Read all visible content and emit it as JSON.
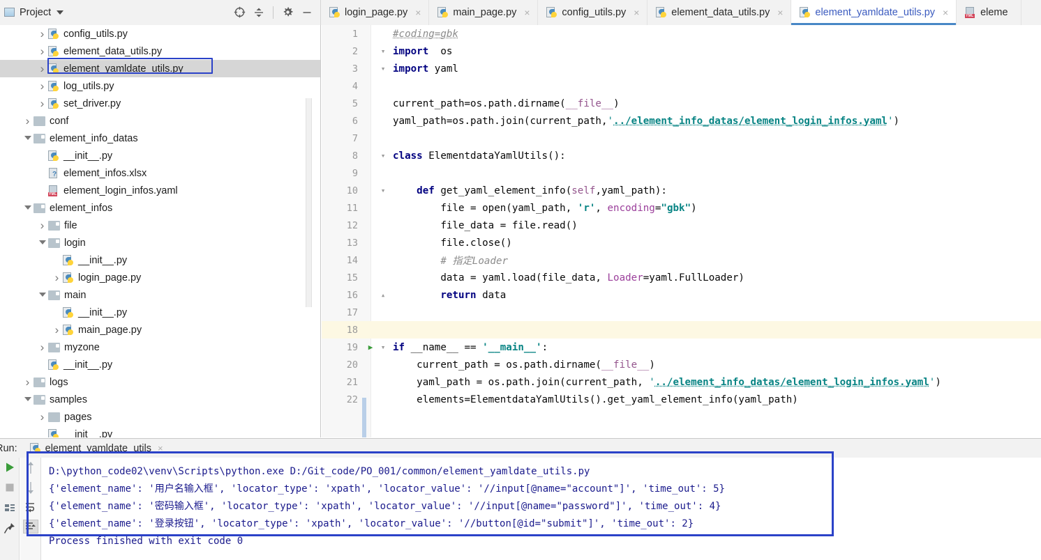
{
  "window": {
    "project_panel_title": "Project",
    "project_icon": "project-panel-icon",
    "dropdown_icon": "chevron-down-icon",
    "tools": [
      {
        "name": "locate-target-icon",
        "title": "Select Opened File"
      },
      {
        "name": "collapse-all-icon",
        "title": "Collapse All"
      },
      {
        "name": "gear-icon",
        "title": "Settings"
      },
      {
        "name": "minimize-icon",
        "title": "Hide"
      }
    ]
  },
  "tabs": [
    {
      "label": "login_page.py",
      "icon": "python-file-icon",
      "close": "×",
      "active": false
    },
    {
      "label": "main_page.py",
      "icon": "python-file-icon",
      "close": "×",
      "active": false
    },
    {
      "label": "config_utils.py",
      "icon": "python-file-icon",
      "close": "×",
      "active": false
    },
    {
      "label": "element_data_utils.py",
      "icon": "python-file-icon",
      "close": "×",
      "active": false
    },
    {
      "label": "element_yamldate_utils.py",
      "icon": "python-file-icon",
      "close": "×",
      "active": true
    },
    {
      "label": "eleme",
      "icon": "yaml-file-icon",
      "close": "",
      "active": false
    }
  ],
  "tree": [
    {
      "label": "config_utils.py",
      "indent": 2,
      "arrow": "collapsed",
      "icon": "python-file-icon",
      "selected": false
    },
    {
      "label": "element_data_utils.py",
      "indent": 2,
      "arrow": "collapsed",
      "icon": "python-file-icon",
      "selected": false
    },
    {
      "label": "element_yamldate_utils.py",
      "indent": 2,
      "arrow": "collapsed",
      "icon": "python-file-icon",
      "selected": true
    },
    {
      "label": "log_utils.py",
      "indent": 2,
      "arrow": "collapsed",
      "icon": "python-file-icon",
      "selected": false
    },
    {
      "label": "set_driver.py",
      "indent": 2,
      "arrow": "collapsed",
      "icon": "python-file-icon",
      "selected": false
    },
    {
      "label": "conf",
      "indent": 1,
      "arrow": "collapsed",
      "icon": "folder-icon",
      "selected": false
    },
    {
      "label": "element_info_datas",
      "indent": 1,
      "arrow": "expanded",
      "icon": "package-folder-icon",
      "selected": false
    },
    {
      "label": "__init__.py",
      "indent": 2,
      "arrow": "none",
      "icon": "python-file-icon",
      "selected": false
    },
    {
      "label": "element_infos.xlsx",
      "indent": 2,
      "arrow": "none",
      "icon": "xls-file-icon",
      "selected": false
    },
    {
      "label": "element_login_infos.yaml",
      "indent": 2,
      "arrow": "none",
      "icon": "yaml-file-icon",
      "selected": false
    },
    {
      "label": "element_infos",
      "indent": 1,
      "arrow": "expanded",
      "icon": "package-folder-icon",
      "selected": false
    },
    {
      "label": "file",
      "indent": 2,
      "arrow": "collapsed",
      "icon": "package-folder-icon",
      "selected": false
    },
    {
      "label": "login",
      "indent": 2,
      "arrow": "expanded",
      "icon": "package-folder-icon",
      "selected": false
    },
    {
      "label": "__init__.py",
      "indent": 3,
      "arrow": "none",
      "icon": "python-file-icon",
      "selected": false
    },
    {
      "label": "login_page.py",
      "indent": 3,
      "arrow": "collapsed",
      "icon": "python-file-icon",
      "selected": false
    },
    {
      "label": "main",
      "indent": 2,
      "arrow": "expanded",
      "icon": "package-folder-icon",
      "selected": false
    },
    {
      "label": "__init__.py",
      "indent": 3,
      "arrow": "none",
      "icon": "python-file-icon",
      "selected": false
    },
    {
      "label": "main_page.py",
      "indent": 3,
      "arrow": "collapsed",
      "icon": "python-file-icon",
      "selected": false
    },
    {
      "label": "myzone",
      "indent": 2,
      "arrow": "collapsed",
      "icon": "package-folder-icon",
      "selected": false
    },
    {
      "label": "__init__.py",
      "indent": 2,
      "arrow": "none",
      "icon": "python-file-icon",
      "selected": false
    },
    {
      "label": "logs",
      "indent": 1,
      "arrow": "collapsed",
      "icon": "package-folder-icon",
      "selected": false
    },
    {
      "label": "samples",
      "indent": 1,
      "arrow": "expanded",
      "icon": "package-folder-icon",
      "selected": false
    },
    {
      "label": "pages",
      "indent": 2,
      "arrow": "collapsed",
      "icon": "folder-icon",
      "selected": false
    },
    {
      "label": "__init__.py",
      "indent": 2,
      "arrow": "none",
      "icon": "python-file-icon",
      "selected": false
    }
  ],
  "editor": {
    "current_line": 18,
    "run_marker_line": 19,
    "lines": [
      {
        "n": "1",
        "fold": "",
        "html": "<span class=\"cm lnk\">#coding=gbk</span>"
      },
      {
        "n": "2",
        "fold": "v",
        "html": "<span class=\"k\">import</span>  os"
      },
      {
        "n": "3",
        "fold": "v",
        "html": "<span class=\"k\">import</span> yaml"
      },
      {
        "n": "4",
        "fold": "",
        "html": ""
      },
      {
        "n": "5",
        "fold": "",
        "html": "current_path=os.path.dirname(<span class=\"self\">__file__</span>)"
      },
      {
        "n": "6",
        "fold": "",
        "html": "yaml_path=os.path.join(current_path,<span class=\"st\">'</span><span class=\"s lnk\">../element_info_datas/element_login_infos.yaml</span><span class=\"st\">'</span>)"
      },
      {
        "n": "7",
        "fold": "",
        "html": ""
      },
      {
        "n": "8",
        "fold": "v",
        "html": "<span class=\"k\">class</span> ElementdataYamlUtils():"
      },
      {
        "n": "9",
        "fold": "",
        "html": ""
      },
      {
        "n": "10",
        "fold": "v",
        "html": "    <span class=\"k\">def</span> get_yaml_element_info(<span class=\"self\">self</span>,yaml_path):"
      },
      {
        "n": "11",
        "fold": "",
        "html": "        file = open(yaml_path, <span class=\"s\">'r'</span>, <span class=\"kw2\">encoding</span>=<span class=\"s\">\"gbk\"</span>)"
      },
      {
        "n": "12",
        "fold": "",
        "html": "        file_data = file.read()"
      },
      {
        "n": "13",
        "fold": "",
        "html": "        file.close()"
      },
      {
        "n": "14",
        "fold": "",
        "html": "        <span class=\"cm\"># 指定Loader</span>"
      },
      {
        "n": "15",
        "fold": "",
        "html": "        data = yaml.load(file_data, <span class=\"kw2\">Loader</span>=yaml.FullLoader)"
      },
      {
        "n": "16",
        "fold": "^",
        "html": "        <span class=\"k\">return</span> data"
      },
      {
        "n": "17",
        "fold": "",
        "html": ""
      },
      {
        "n": "18",
        "fold": "",
        "html": ""
      },
      {
        "n": "19",
        "fold": "v",
        "html": "<span class=\"k\">if</span> __name__ == <span class=\"s\">'__main__'</span>:"
      },
      {
        "n": "20",
        "fold": "",
        "html": "    current_path = os.path.dirname(<span class=\"self\">__file__</span>)"
      },
      {
        "n": "21",
        "fold": "",
        "html": "    yaml_path = os.path.join(current_path, <span class=\"st\">'</span><span class=\"s lnk\">../element_info_datas/element_login_infos.yaml</span><span class=\"st\">'</span>)"
      },
      {
        "n": "22",
        "fold": "",
        "html": "    elements=ElementdataYamlUtils().get_yaml_element_info(yaml_path)"
      }
    ]
  },
  "run_panel": {
    "label": "Run:",
    "tab_label": "element_yamldate_utils",
    "tab_icon": "python-file-icon",
    "tab_close": "×",
    "side_icons": [
      {
        "name": "run-icon"
      },
      {
        "name": "stop-icon"
      },
      {
        "name": "console-icon"
      },
      {
        "name": "pin-icon"
      }
    ],
    "side_icons_2": [
      {
        "name": "arrow-up-icon"
      },
      {
        "name": "arrow-down-icon"
      },
      {
        "name": "soft-wrap-icon"
      },
      {
        "name": "scroll-to-end-icon"
      }
    ],
    "console_lines": [
      "D:\\python_code02\\venv\\Scripts\\python.exe D:/Git_code/PO_001/common/element_yamldate_utils.py",
      "{'element_name': '用户名输入框', 'locator_type': 'xpath', 'locator_value': '//input[@name=\"account\"]', 'time_out': 5}",
      "{'element_name': '密码输入框', 'locator_type': 'xpath', 'locator_value': '//input[@name=\"password\"]', 'time_out': 4}",
      "{'element_name': '登录按钮', 'locator_type': 'xpath', 'locator_value': '//button[@id=\"submit\"]', 'time_out': 2}",
      "",
      "Process finished with exit code 0"
    ],
    "annotation_color": "#2b42c8"
  }
}
